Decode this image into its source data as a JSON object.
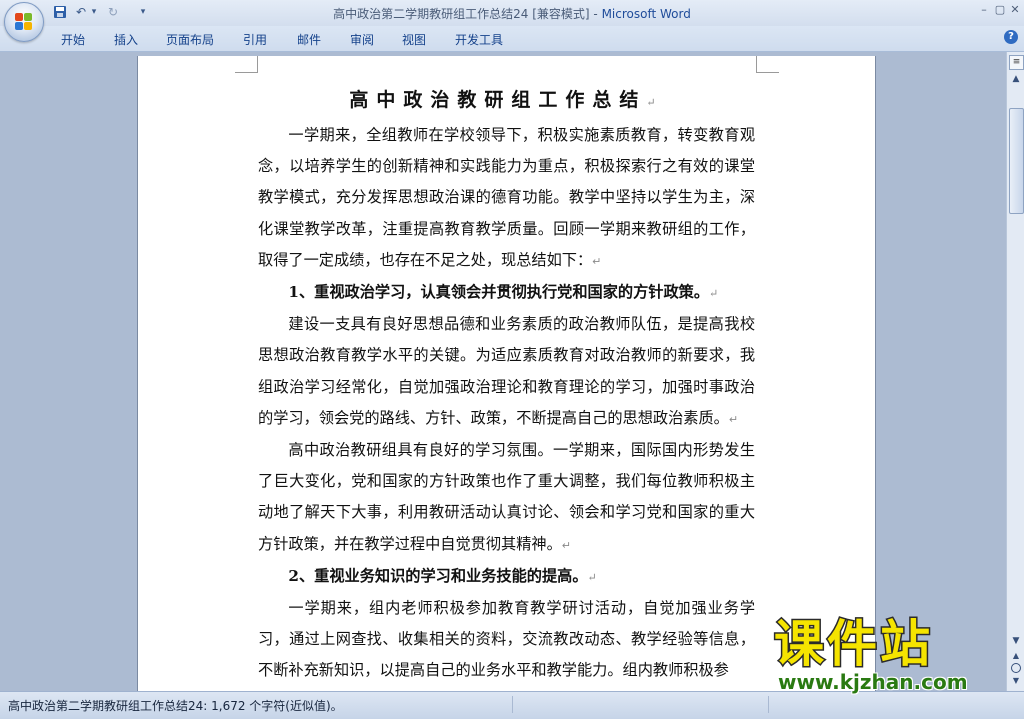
{
  "window": {
    "doc_title": "高中政治第二学期教研组工作总结24 [兼容模式]",
    "separator": " - ",
    "app_name": "Microsoft Word",
    "minimize": "–",
    "maximize": "▢",
    "close": "✕"
  },
  "quick_access": {
    "save_icon": "save-icon",
    "undo": "↶",
    "undo_dropdown": "▾",
    "redo": "↻",
    "customize": "▾"
  },
  "ribbon": {
    "tabs": [
      "开始",
      "插入",
      "页面布局",
      "引用",
      "邮件",
      "审阅",
      "视图",
      "开发工具"
    ],
    "help": "?"
  },
  "document": {
    "title": "高中政治教研组工作总结",
    "pilcrow": "↵",
    "paragraphs": [
      "一学期来，全组教师在学校领导下，积极实施素质教育，转变教育观念，以培养学生的创新精神和实践能力为重点，积极探索行之有效的课堂教学模式，充分发挥思想政治课的德育功能。教学中坚持以学生为主，深化课堂教学改革，注重提高教育教学质量。回顾一学期来教研组的工作，取得了一定成绩，也存在不足之处，现总结如下：",
      "1、重视政治学习，认真领会并贯彻执行党和国家的方针政策。",
      "建设一支具有良好思想品德和业务素质的政治教师队伍，是提高我校思想政治教育教学水平的关键。为适应素质教育对政治教师的新要求，我组政治学习经常化，自觉加强政治理论和教育理论的学习，加强时事政治的学习，领会党的路线、方针、政策，不断提高自己的思想政治素质。",
      "高中政治教研组具有良好的学习氛围。一学期来，国际国内形势发生了巨大变化，党和国家的方针政策也作了重大调整，我们每位教师积极主动地了解天下大事，利用教研活动认真讨论、领会和学习党和国家的重大方针政策，并在教学过程中自觉贯彻其精神。",
      "2、重视业务知识的学习和业务技能的提高。",
      "一学期来，组内老师积极参加教育教学研讨活动，自觉加强业务学习，通过上网查找、收集相关的资料，交流教改动态、教学经验等信息，不断补充新知识，以提高自己的业务水平和教学能力。组内教师积极参"
    ]
  },
  "statusbar": {
    "text": "高中政治第二学期教研组工作总结24: 1,672 个字符(近似值)。"
  },
  "watermark": {
    "brand": "课件站",
    "url": "www.kjzhan.com"
  }
}
